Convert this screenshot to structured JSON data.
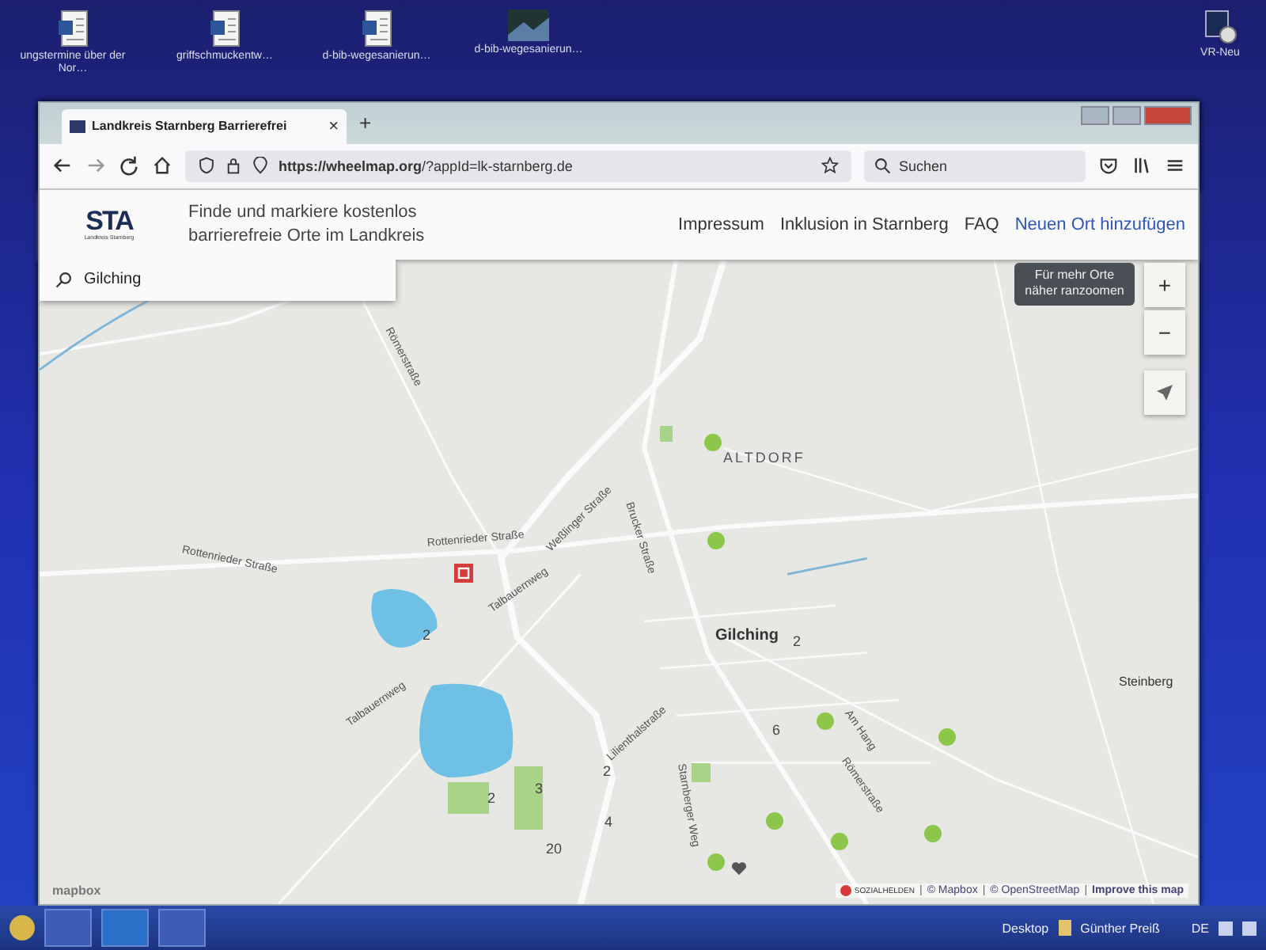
{
  "desktop": {
    "icons": [
      {
        "label": "ungstermine über der Nor…",
        "kind": "doc"
      },
      {
        "label": "griffschmuckentw…",
        "kind": "doc"
      },
      {
        "label": "d-bib-wegesanierun…",
        "kind": "doc"
      },
      {
        "label": "d-bib-wegesanierun…",
        "kind": "photo"
      }
    ],
    "side_icons": [
      {
        "label": "VR-Neu"
      }
    ]
  },
  "browser": {
    "tab_title": "Landkreis Starnberg Barrierefrei",
    "url_host": "https://wheelmap.org",
    "url_rest": "/?appId=lk-starnberg.de",
    "search_placeholder": "Suchen",
    "new_tab": "+",
    "tab_close": "×"
  },
  "page": {
    "logo": "STA",
    "logo_subtitle": "Landkreis Starnberg",
    "tagline": "Finde und markiere kostenlos barrierefreie Orte im Landkreis",
    "nav": [
      {
        "label": "Impressum",
        "kind": "link"
      },
      {
        "label": "Inklusion in Starnberg",
        "kind": "link"
      },
      {
        "label": "FAQ",
        "kind": "link"
      },
      {
        "label": "Neuen Ort hinzufügen",
        "kind": "primary"
      }
    ],
    "search_value": "Gilching",
    "tooltip": "Für mehr Orte näher ranzoomen",
    "zoom_in": "+",
    "zoom_out": "−",
    "map": {
      "places": [
        {
          "label": "ALTDORF",
          "kind": "district"
        },
        {
          "label": "Gilching",
          "kind": "town"
        },
        {
          "label": "Steinberg",
          "kind": "village"
        }
      ],
      "streets": [
        "Römerstraße",
        "Rottenrieder Straße",
        "Rottenrieder Straße",
        "Brucker Straße",
        "Weßlinger Straße",
        "Talbauernweg",
        "Talbauernweg",
        "Starnberger Weg",
        "Lilienthalstraße",
        "Am Hang",
        "Römerstraße"
      ],
      "clusters": [
        "2",
        "2",
        "3",
        "2",
        "4",
        "20",
        "6",
        "2"
      ],
      "pois": [
        {
          "kind": "marker"
        },
        {
          "kind": "marker"
        },
        {
          "kind": "marker"
        },
        {
          "kind": "marker"
        },
        {
          "kind": "marker"
        },
        {
          "kind": "marker"
        },
        {
          "kind": "marker"
        },
        {
          "kind": "marker"
        },
        {
          "kind": "toilet"
        },
        {
          "kind": "heart"
        }
      ]
    },
    "attribution": [
      {
        "label": "SOZIALHELDEN",
        "kind": "brand"
      },
      {
        "label": "© Mapbox",
        "kind": "link"
      },
      {
        "label": "© OpenStreetMap",
        "kind": "link"
      },
      {
        "label": "Improve this map",
        "kind": "bold"
      }
    ],
    "attribution_separator": "|",
    "map_logo": "mapbox"
  },
  "taskbar": {
    "desktop_label": "Desktop",
    "user": "Günther Preiß",
    "language": "DE"
  }
}
